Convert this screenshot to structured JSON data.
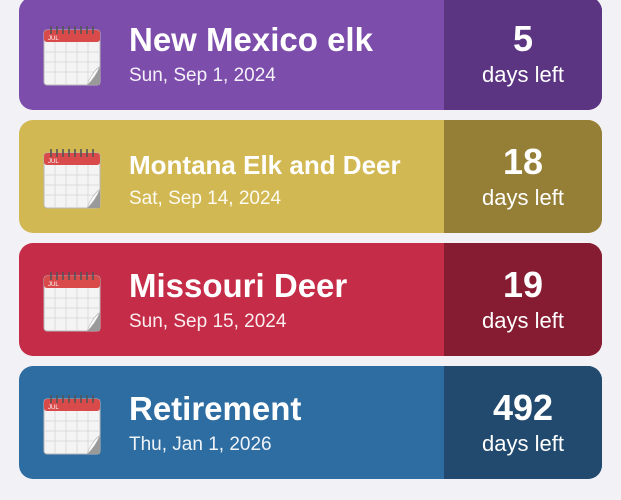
{
  "events": [
    {
      "title": "New Mexico elk",
      "date": "Sun, Sep 1, 2024",
      "days": "5",
      "unit": "days left",
      "colors": {
        "main": "#7c4dab",
        "count": "#5b3582"
      },
      "icon": "calendar-icon",
      "icon_text": "JUL"
    },
    {
      "title": "Montana Elk and Deer",
      "date": "Sat, Sep 14, 2024",
      "days": "18",
      "unit": "days left",
      "colors": {
        "main": "#d2b852",
        "count": "#957f37"
      },
      "icon": "calendar-icon",
      "icon_text": "JUL"
    },
    {
      "title": "Missouri Deer",
      "date": "Sun, Sep 15, 2024",
      "days": "19",
      "unit": "days left",
      "colors": {
        "main": "#c52c48",
        "count": "#861c31"
      },
      "icon": "calendar-icon",
      "icon_text": "JUL"
    },
    {
      "title": "Retirement",
      "date": "Thu, Jan 1, 2026",
      "days": "492",
      "unit": "days left",
      "colors": {
        "main": "#2e6da2",
        "count": "#214a6e"
      },
      "icon": "calendar-icon",
      "icon_text": "JUL"
    }
  ]
}
